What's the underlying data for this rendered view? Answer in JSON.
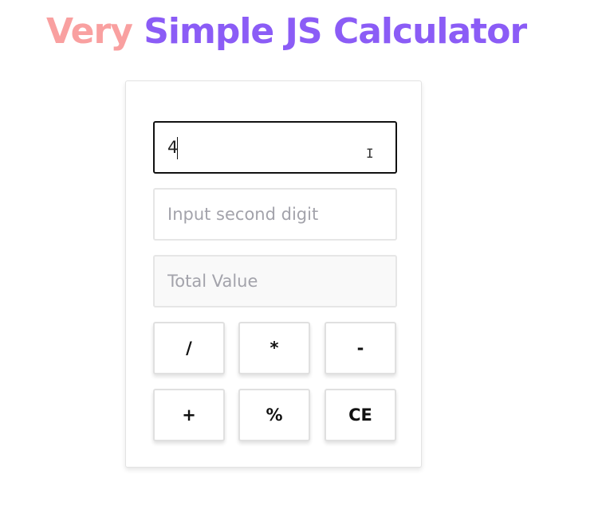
{
  "header": {
    "title_word_1": "Very",
    "title_rest": "Simple JS Calculator",
    "colors": {
      "accent_pink": "#f9a0a0",
      "accent_purple": "#8b5cf6"
    }
  },
  "calculator": {
    "first_input": {
      "value": "4",
      "placeholder": ""
    },
    "second_input": {
      "value": "",
      "placeholder": "Input second digit"
    },
    "total_input": {
      "value": "",
      "placeholder": "Total Value"
    },
    "buttons": {
      "divide": "/",
      "multiply": "*",
      "subtract": "-",
      "add": "+",
      "modulo": "%",
      "clear": "CE"
    }
  }
}
